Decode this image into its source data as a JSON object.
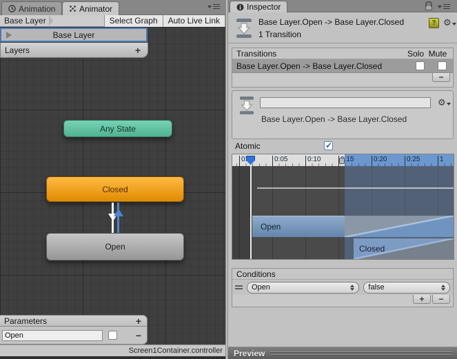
{
  "left_pane": {
    "tabs": {
      "animation": "Animation",
      "animator": "Animator"
    },
    "toolbar": {
      "breadcrumb": "Base Layer",
      "select_graph": "Select Graph",
      "auto_live_link": "Auto Live Link"
    },
    "layer_item": "Base Layer",
    "layers": {
      "title": "Layers",
      "add": "+"
    },
    "graph": {
      "any_state": "Any State",
      "closed": "Closed",
      "open": "Open"
    },
    "parameters": {
      "title": "Parameters",
      "add": "+",
      "remove": "−",
      "param_value": "Open"
    },
    "status": "Screen1Container.controller"
  },
  "inspector": {
    "tab": "Inspector",
    "header": {
      "title": "Base Layer.Open -> Base Layer.Closed",
      "subtitle": "1 Transition",
      "help_glyph": "?"
    },
    "transitions": {
      "title": "Transitions",
      "solo": "Solo",
      "mute": "Mute",
      "row": "Base Layer.Open -> Base Layer.Closed",
      "remove": "−"
    },
    "detail": {
      "name_value": "",
      "label": "Base Layer.Open -> Base Layer.Closed"
    },
    "atomic": "Atomic",
    "timeline": {
      "ticks": [
        "0:00",
        "0:05",
        "0:10",
        "0:15",
        "0:20",
        "0:25",
        "1"
      ],
      "open": "Open",
      "closed": "Closed"
    },
    "conditions": {
      "title": "Conditions",
      "param": "Open",
      "value": "false",
      "add": "+",
      "remove": "−"
    },
    "preview": "Preview"
  },
  "colors": {
    "selection_blue": "#4a7ab5",
    "playhead_blue": "#2f72d9",
    "timeline_blue": "#6c98d0",
    "node_teal": "#5fc1a2",
    "node_orange": "#f09c1d",
    "node_gray": "#aeaeae",
    "graph_bg": "#3f3f3f"
  }
}
